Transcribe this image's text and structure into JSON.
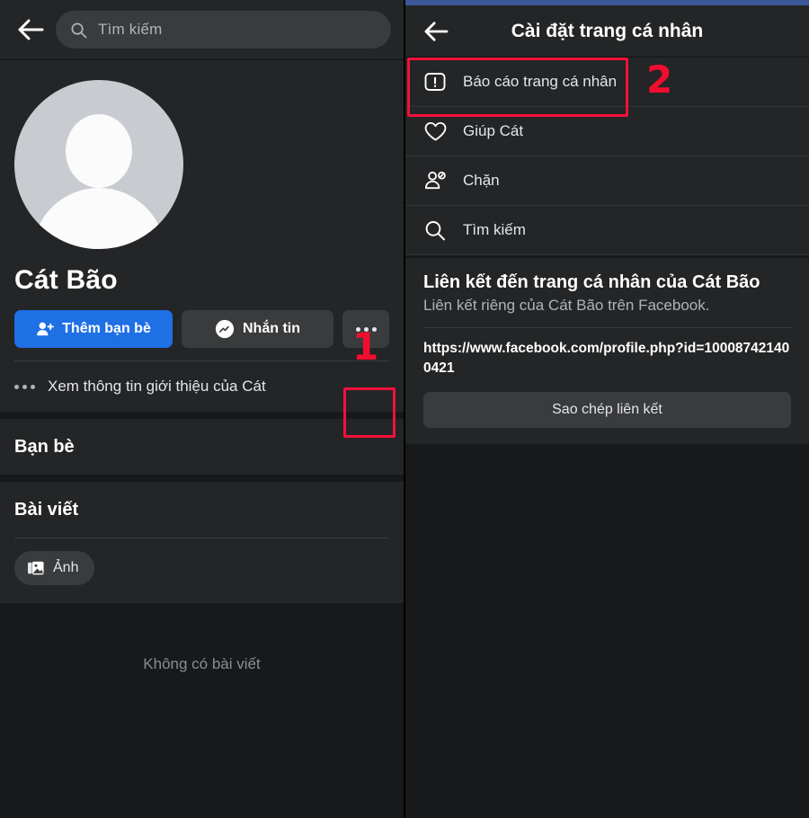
{
  "colors": {
    "app_bg": "#18191a",
    "card_bg": "#242526",
    "control_bg": "#3a3b3c",
    "primary_blue": "#1f6fe5",
    "brand_strip_blue": "#3b5998",
    "annotation_red": "#f20d2f",
    "text_primary": "#e4e6eb",
    "text_secondary": "#b0b3b8"
  },
  "left_panel": {
    "back_icon": "back-arrow-icon",
    "search": {
      "icon": "search-icon",
      "placeholder": "Tìm kiếm",
      "value": ""
    },
    "profile": {
      "avatar_icon": "default-avatar-icon",
      "name": "Cát Bão",
      "actions": {
        "add_friend_label": "Thêm bạn bè",
        "add_friend_icon": "add-friend-icon",
        "message_label": "Nhắn tin",
        "message_icon": "messenger-icon",
        "more_icon": "ellipsis-icon"
      },
      "about_row": {
        "icon": "ellipsis-icon",
        "label": "Xem thông tin giới thiệu của Cát"
      }
    },
    "sections": [
      {
        "title": "Bạn bè"
      },
      {
        "title": "Bài viết"
      }
    ],
    "composer_chip": {
      "icon": "photo-icon",
      "label": "Ảnh"
    },
    "empty_state": "Không có bài viết"
  },
  "right_panel": {
    "back_icon": "back-arrow-icon",
    "title": "Cài đặt trang cá nhân",
    "menu_items": [
      {
        "icon": "report-icon",
        "label": "Báo cáo trang cá nhân",
        "highlighted": true
      },
      {
        "icon": "heart-icon",
        "label": "Giúp Cát",
        "highlighted": false
      },
      {
        "icon": "block-icon",
        "label": "Chặn",
        "highlighted": false
      },
      {
        "icon": "search-icon",
        "label": "Tìm kiếm",
        "highlighted": false
      }
    ],
    "link_card": {
      "title": "Liên kết đến trang cá nhân của Cát Bão",
      "subtitle": "Liên kết riêng của Cát Bão trên Facebook.",
      "url": "https://www.facebook.com/profile.php?id=100087421400421",
      "copy_label": "Sao chép liên kết"
    }
  },
  "annotations": {
    "step_one": "1",
    "step_two": "2"
  }
}
